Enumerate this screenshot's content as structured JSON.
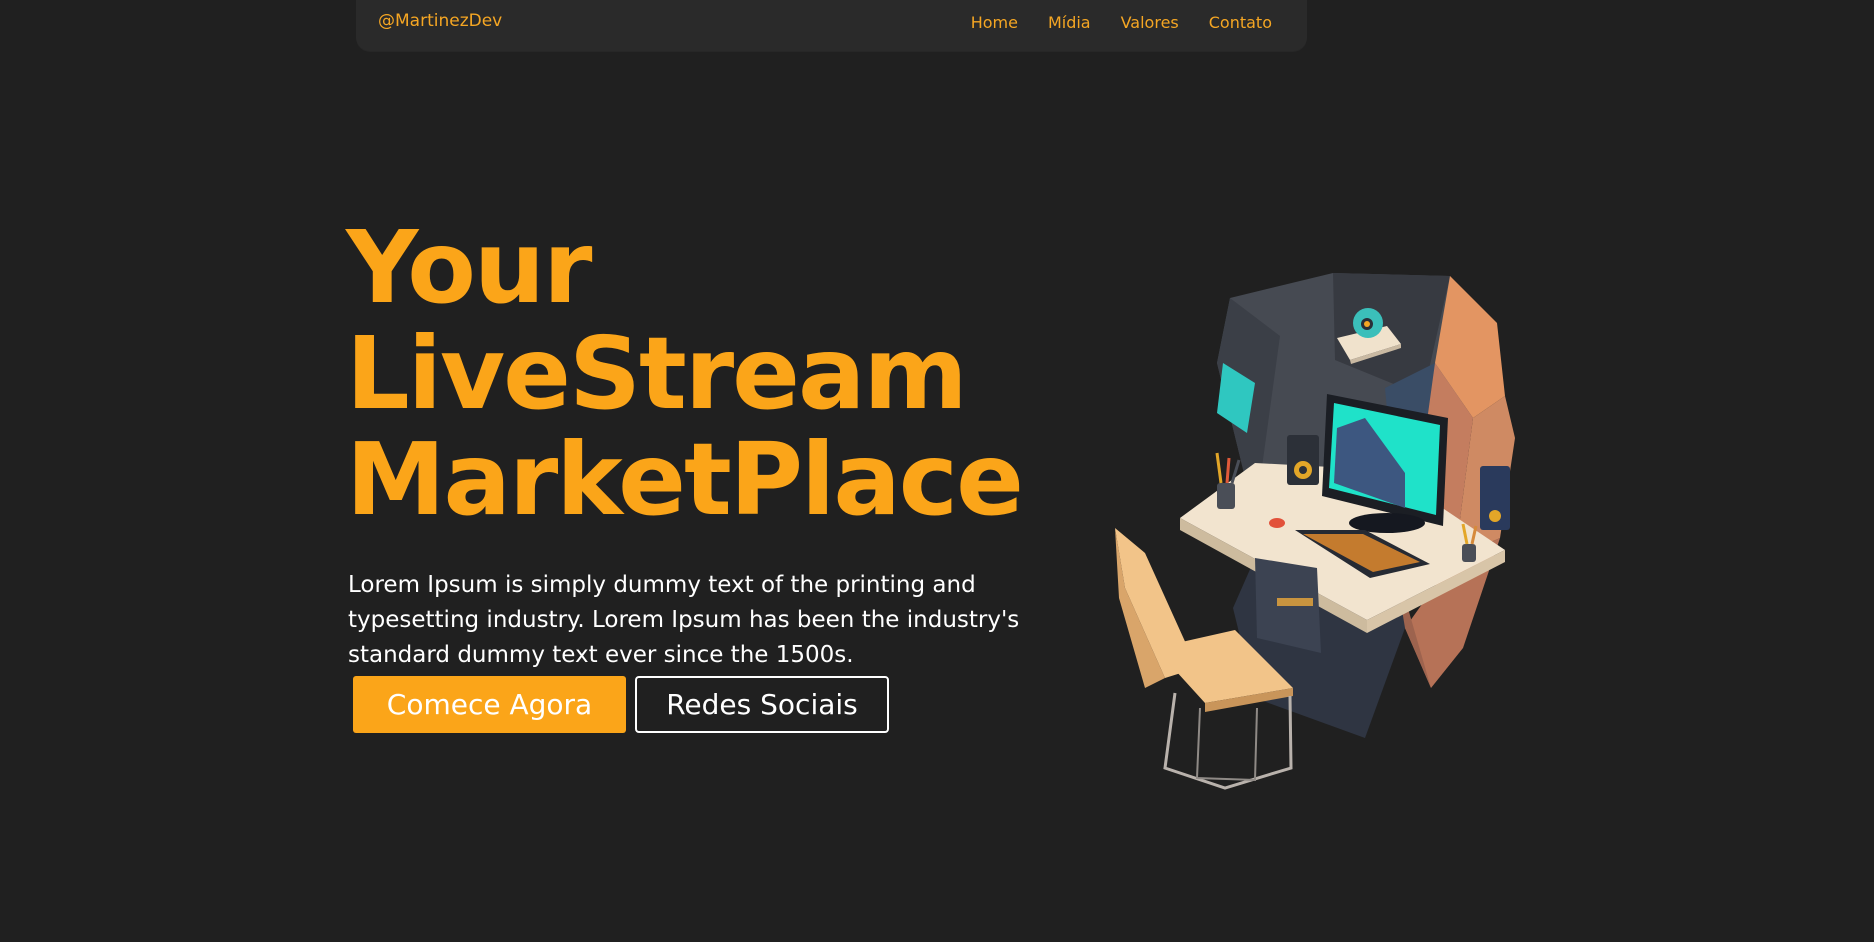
{
  "navbar": {
    "brand": "@MartinezDev",
    "links": [
      "Home",
      "Mídia",
      "Valores",
      "Contato"
    ]
  },
  "hero": {
    "title_lines": [
      "Your",
      "LiveStream",
      "MarketPlace"
    ],
    "description": "Lorem Ipsum is simply dummy text of the printing and typesetting industry. Lorem Ipsum has been the industry's standard dummy text ever since the 1500s.",
    "primary_button": "Comece Agora",
    "secondary_button": "Redes Sociais"
  },
  "illustration": {
    "icon": "gaming-desk-setup-illustration"
  },
  "colors": {
    "background": "#202020",
    "navbar": "#2a2a2a",
    "accent": "#fba519",
    "text": "#ffffff"
  }
}
